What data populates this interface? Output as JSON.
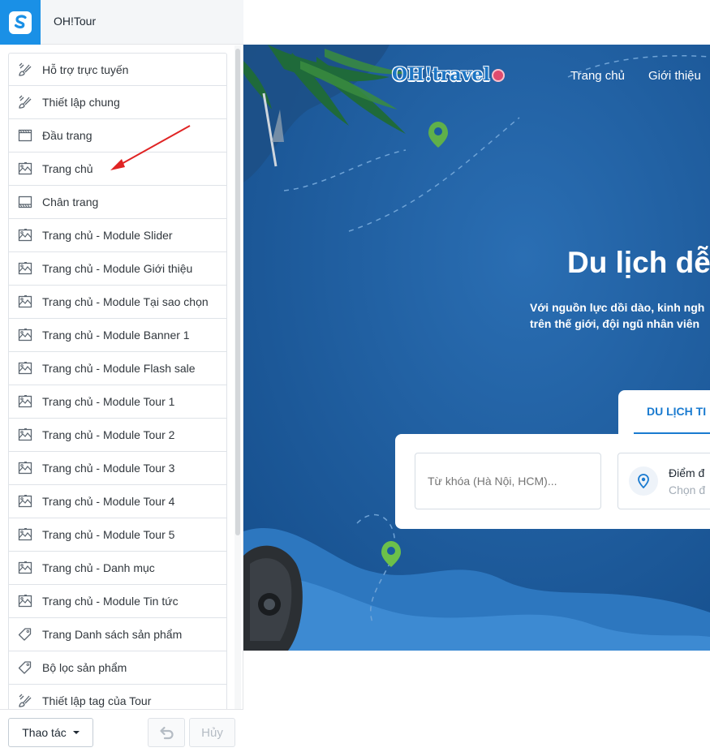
{
  "app": {
    "store_name": "OH!Tour"
  },
  "sidebar": {
    "items": [
      {
        "label": "Hỗ trợ trực tuyến",
        "icon": "brush-icon"
      },
      {
        "label": "Thiết lập chung",
        "icon": "brush-icon"
      },
      {
        "label": "Đầu trang",
        "icon": "header-layout-icon"
      },
      {
        "label": "Trang chủ",
        "icon": "image-layout-icon"
      },
      {
        "label": "Chân trang",
        "icon": "footer-layout-icon"
      },
      {
        "label": "Trang chủ - Module Slider",
        "icon": "image-layout-icon"
      },
      {
        "label": "Trang chủ - Module Giới thiệu",
        "icon": "image-layout-icon"
      },
      {
        "label": "Trang chủ - Module Tại sao chọn",
        "icon": "image-layout-icon"
      },
      {
        "label": "Trang chủ - Module Banner 1",
        "icon": "image-layout-icon"
      },
      {
        "label": "Trang chủ - Module Flash sale",
        "icon": "image-layout-icon"
      },
      {
        "label": "Trang chủ - Module Tour 1",
        "icon": "image-layout-icon"
      },
      {
        "label": "Trang chủ - Module Tour 2",
        "icon": "image-layout-icon"
      },
      {
        "label": "Trang chủ - Module Tour 3",
        "icon": "image-layout-icon"
      },
      {
        "label": "Trang chủ - Module Tour 4",
        "icon": "image-layout-icon"
      },
      {
        "label": "Trang chủ - Module Tour 5",
        "icon": "image-layout-icon"
      },
      {
        "label": "Trang chủ - Danh mục",
        "icon": "image-layout-icon"
      },
      {
        "label": "Trang chủ - Module Tin tức",
        "icon": "image-layout-icon"
      },
      {
        "label": "Trang Danh sách sản phẩm",
        "icon": "tag-icon"
      },
      {
        "label": "Bộ lọc sản phẩm",
        "icon": "tag-icon"
      },
      {
        "label": "Thiết lập tag của Tour",
        "icon": "brush-icon"
      }
    ]
  },
  "footer": {
    "action_label": "Thao tác",
    "cancel_label": "Hủy"
  },
  "preview": {
    "logo_text": "OH!travel",
    "nav": [
      "Trang chủ",
      "Giới thiệu"
    ],
    "hero_title": "Du lịch dễ",
    "hero_line1": "Với nguồn lực dồi dào, kinh ngh",
    "hero_line2": "trên thế giới, đội ngũ nhân viên",
    "tab_label": "DU LỊCH TI",
    "search_placeholder": "Từ khóa (Hà Nội, HCM)...",
    "destination_title": "Điểm đ",
    "destination_sub": "Chọn đ"
  },
  "colors": {
    "accent": "#1a90e6",
    "hero_bg": "#1b5c9e",
    "annotation": "#e02424"
  }
}
